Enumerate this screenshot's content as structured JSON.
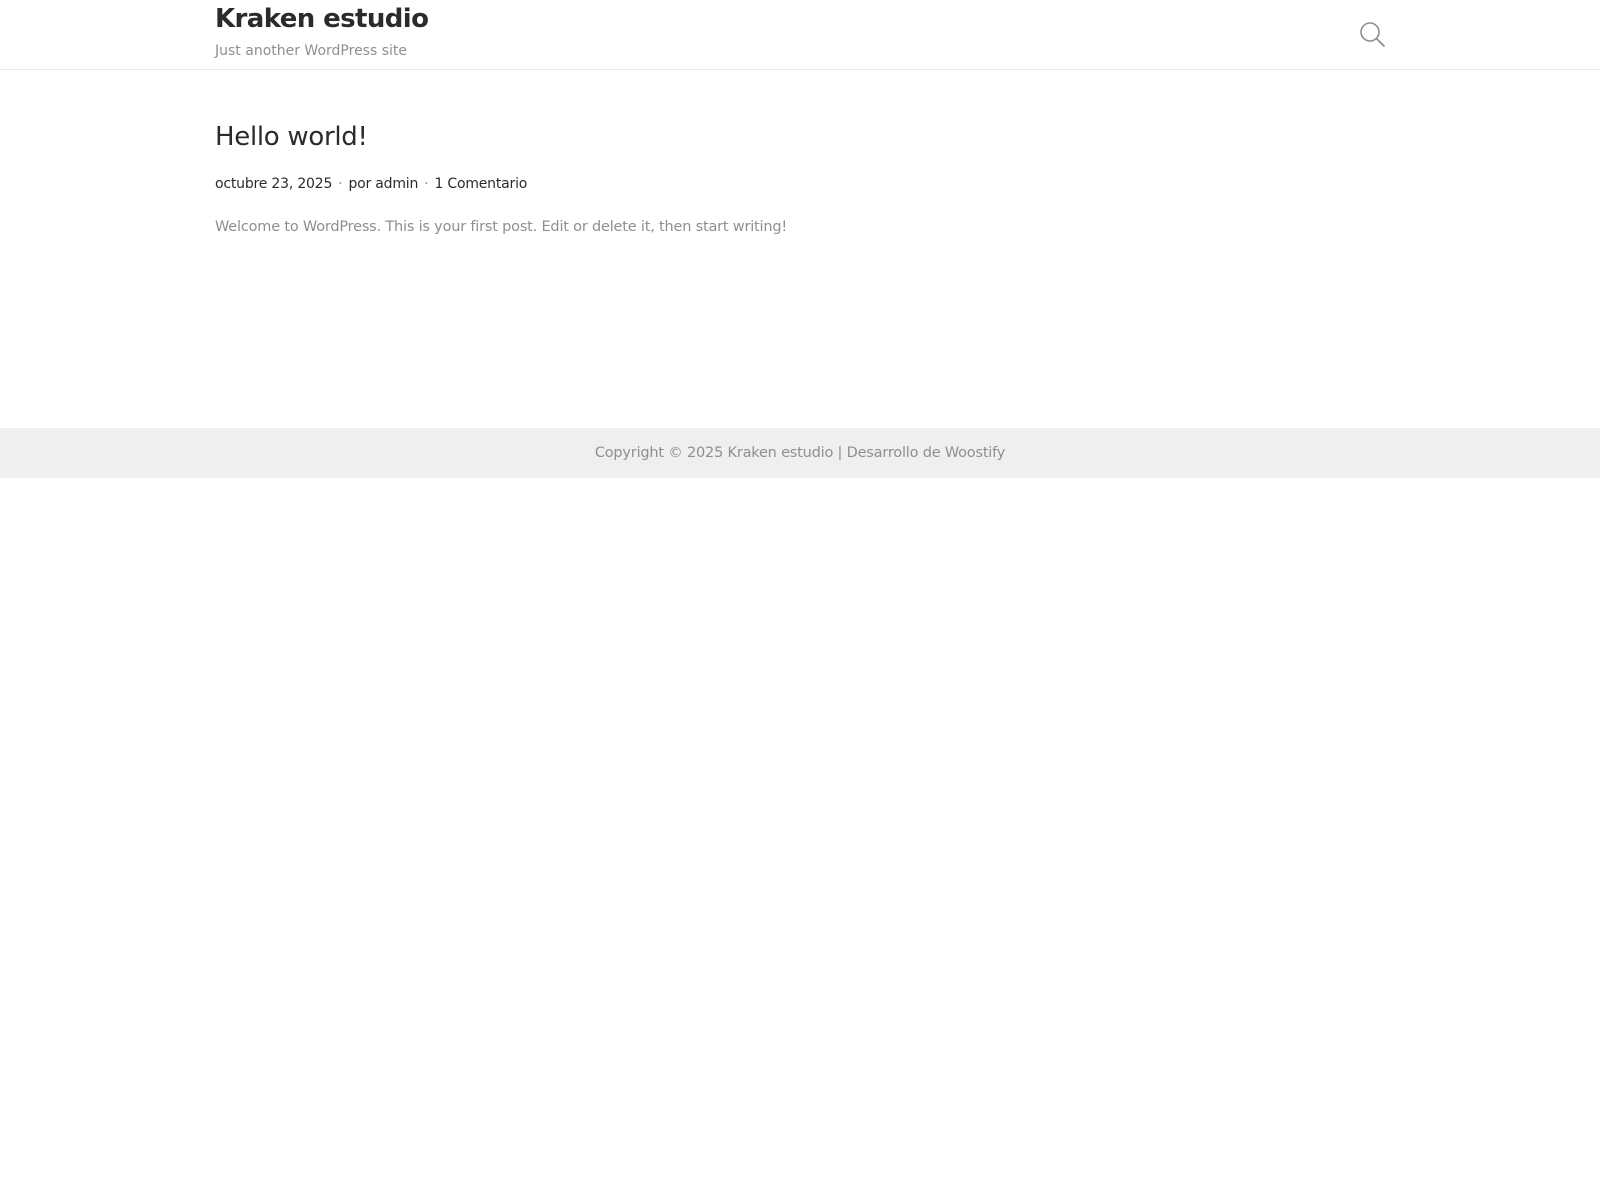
{
  "header": {
    "site_title": "Kraken estudio",
    "tagline": "Just another WordPress site",
    "search_icon": "search-icon"
  },
  "post": {
    "title": "Hello world!",
    "date": "octubre 23, 2025",
    "separator": "·",
    "author": "por admin",
    "comments": "1 Comentario",
    "excerpt": "Welcome to WordPress. This is your first post. Edit or delete it, then start writing!"
  },
  "footer": {
    "copyright": "Copyright © 2025 Kraken estudio | Desarrollo de Woostify"
  },
  "colors": {
    "text": "#2b2b2b",
    "muted": "#8f8f8f",
    "footer_bg": "#efefee",
    "border": "#e6e6e6"
  }
}
